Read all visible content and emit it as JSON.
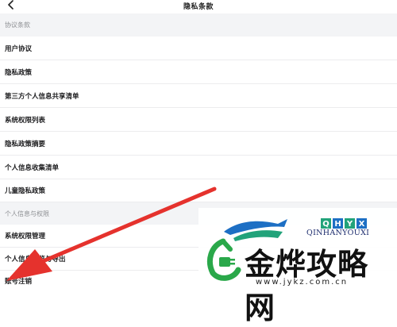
{
  "header": {
    "title": "隐私条款",
    "back_icon": "chevron-left-icon"
  },
  "sections": [
    {
      "label": "协议条款",
      "items": [
        "用户协议",
        "隐私政策",
        "第三方个人信息共享清单",
        "系统权限列表",
        "隐私政策摘要",
        "个人信息收集清单",
        "儿童隐私政策"
      ]
    },
    {
      "label": "个人信息与权限",
      "items": [
        "系统权限管理",
        "个人信息浏览与导出",
        "账号注销"
      ]
    }
  ],
  "watermark": {
    "badge_letters": [
      "Q",
      "H",
      "Y",
      "X"
    ],
    "brand_en": "QINHANYOUXI",
    "brand_cn": "金烨攻略网",
    "url": "www.jykz.com.cn",
    "colors": {
      "blue": "#1d6fc4",
      "teal": "#22a37a",
      "dark": "#1a2a6c"
    }
  },
  "annotation": {
    "type": "arrow",
    "color": "#e5322d",
    "points_to": "账号注销"
  }
}
